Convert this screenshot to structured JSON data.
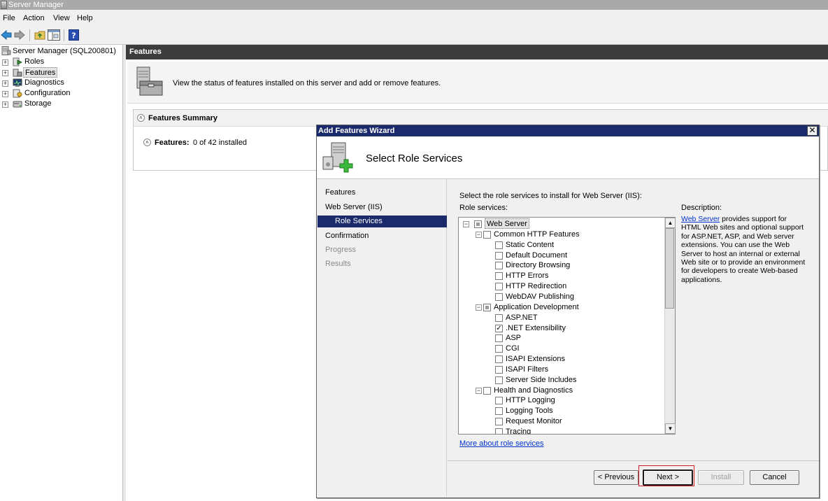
{
  "window": {
    "title": "Server Manager"
  },
  "menu": [
    "File",
    "Action",
    "View",
    "Help"
  ],
  "toolbar": {
    "icons": [
      "back-arrow-icon",
      "forward-arrow-icon",
      "up-folder-icon",
      "show-hide-console-tree-icon",
      "help-icon"
    ]
  },
  "tree": {
    "root": "Server Manager (SQL200801)",
    "items": [
      "Roles",
      "Features",
      "Diagnostics",
      "Configuration",
      "Storage"
    ],
    "selected": "Features"
  },
  "pane": {
    "header": "Features",
    "intro": "View the status of features installed on this server and add or remove features.",
    "summary_title": "Features Summary",
    "features_label": "Features:",
    "features_value": "0 of 42 installed"
  },
  "wizard": {
    "title": "Add Features Wizard",
    "heading": "Select Role Services",
    "nav": [
      "Features",
      "Web Server (IIS)",
      "Role Services",
      "Confirmation",
      "Progress",
      "Results"
    ],
    "nav_selected": "Role Services",
    "instruction": "Select the role services to install for Web Server (IIS):",
    "list_label": "Role services:",
    "services": [
      {
        "label": "Web Server",
        "level": 0,
        "state": "partial",
        "expanded": true,
        "selected": true
      },
      {
        "label": "Common HTTP Features",
        "level": 1,
        "state": "unchecked",
        "expanded": true
      },
      {
        "label": "Static Content",
        "level": 2,
        "state": "unchecked"
      },
      {
        "label": "Default Document",
        "level": 2,
        "state": "unchecked"
      },
      {
        "label": "Directory Browsing",
        "level": 2,
        "state": "unchecked"
      },
      {
        "label": "HTTP Errors",
        "level": 2,
        "state": "unchecked"
      },
      {
        "label": "HTTP Redirection",
        "level": 2,
        "state": "unchecked"
      },
      {
        "label": "WebDAV Publishing",
        "level": 2,
        "state": "unchecked"
      },
      {
        "label": "Application Development",
        "level": 1,
        "state": "partial",
        "expanded": true
      },
      {
        "label": "ASP.NET",
        "level": 2,
        "state": "unchecked"
      },
      {
        "label": ".NET Extensibility",
        "level": 2,
        "state": "checked"
      },
      {
        "label": "ASP",
        "level": 2,
        "state": "unchecked"
      },
      {
        "label": "CGI",
        "level": 2,
        "state": "unchecked"
      },
      {
        "label": "ISAPI Extensions",
        "level": 2,
        "state": "unchecked"
      },
      {
        "label": "ISAPI Filters",
        "level": 2,
        "state": "unchecked"
      },
      {
        "label": "Server Side Includes",
        "level": 2,
        "state": "unchecked"
      },
      {
        "label": "Health and Diagnostics",
        "level": 1,
        "state": "unchecked",
        "expanded": true
      },
      {
        "label": "HTTP Logging",
        "level": 2,
        "state": "unchecked"
      },
      {
        "label": "Logging Tools",
        "level": 2,
        "state": "unchecked"
      },
      {
        "label": "Request Monitor",
        "level": 2,
        "state": "unchecked"
      },
      {
        "label": "Tracing",
        "level": 2,
        "state": "unchecked"
      }
    ],
    "description_label": "Description:",
    "description_link": "Web Server",
    "description_text": " provides support for HTML Web sites and optional support for ASP.NET, ASP, and Web server extensions. You can use the Web Server to host an internal or external Web site or to provide an environment for developers to create Web-based applications.",
    "more_link": "More about role services",
    "buttons": {
      "previous": "< Previous",
      "next": "Next >",
      "install": "Install",
      "cancel": "Cancel"
    },
    "highlight_color": "#d02020"
  }
}
